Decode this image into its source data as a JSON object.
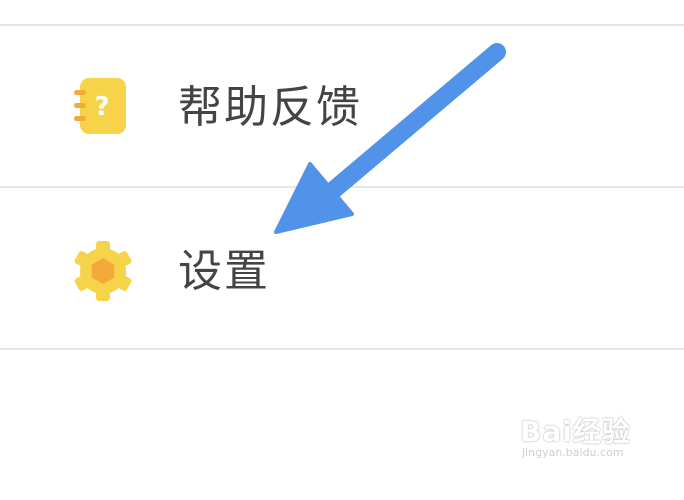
{
  "menu": {
    "items": [
      {
        "label": "帮助反馈",
        "icon": "help-notebook-icon"
      },
      {
        "label": "设置",
        "icon": "settings-gear-icon"
      }
    ]
  },
  "annotation": {
    "icon": "arrow-pointer-icon",
    "color": "#5093e8"
  },
  "watermark": {
    "logo": "Bai经验",
    "url": "jingyan.baidu.com"
  },
  "colors": {
    "icon_yellow": "#f7d34a",
    "icon_orange": "#f4a93b",
    "label_gray": "#444444",
    "divider": "#e6e6e6"
  }
}
